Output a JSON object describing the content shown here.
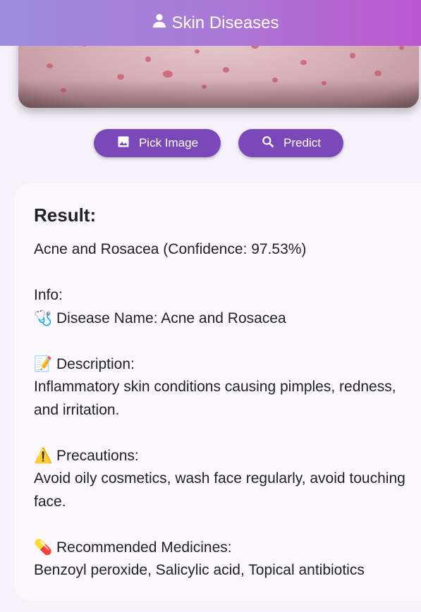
{
  "appbar": {
    "title": "Skin Diseases",
    "icon": "person-icon",
    "gradient": [
      "#9d8ce0",
      "#bb57cf"
    ]
  },
  "actions": {
    "pick_image_label": "Pick Image",
    "predict_label": "Predict",
    "button_color": "#7a48b8"
  },
  "result": {
    "heading": "Result:",
    "text": "Acne and Rosacea (Confidence: 97.53%)\n\nInfo:\n🩺 Disease Name: Acne and Rosacea\n\n📝 Description:\nInflammatory skin conditions causing pimples, redness, and irritation.\n\n⚠️ Precautions:\nAvoid oily cosmetics, wash face regularly, avoid touching face.\n\n💊 Recommended Medicines:\nBenzoyl peroxide, Salicylic acid, Topical antibiotics"
  }
}
